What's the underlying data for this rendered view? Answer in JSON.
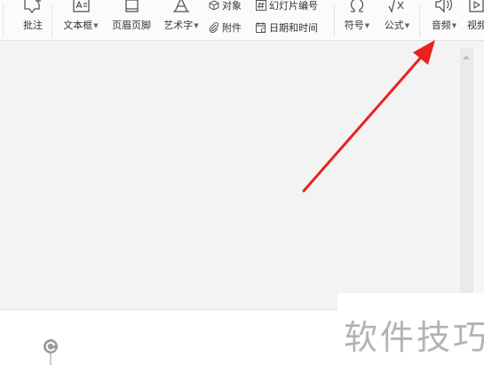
{
  "ribbon": {
    "comment": {
      "label": "批注",
      "icon": "comment-icon"
    },
    "textbox": {
      "label": "文本框",
      "icon": "textbox-icon"
    },
    "header_footer": {
      "label": "页眉页脚",
      "icon": "header-footer-icon"
    },
    "wordart": {
      "label": "艺术字",
      "icon": "wordart-icon"
    },
    "object": {
      "label": "对象",
      "icon": "object-icon"
    },
    "attachment": {
      "label": "附件",
      "icon": "paperclip-icon"
    },
    "slide_number": {
      "label": "幻灯片编号",
      "icon": "slide-number-icon"
    },
    "date_time": {
      "label": "日期和时间",
      "icon": "calendar-icon"
    },
    "symbol": {
      "label": "符号",
      "icon": "omega-icon"
    },
    "formula": {
      "label": "公式",
      "icon": "formula-icon"
    },
    "audio": {
      "label": "音频",
      "icon": "speaker-icon"
    },
    "video": {
      "label": "视频",
      "icon": "video-icon"
    }
  },
  "annotation": {
    "color": "#e8231f"
  },
  "watermark": {
    "text": "软件技巧"
  }
}
